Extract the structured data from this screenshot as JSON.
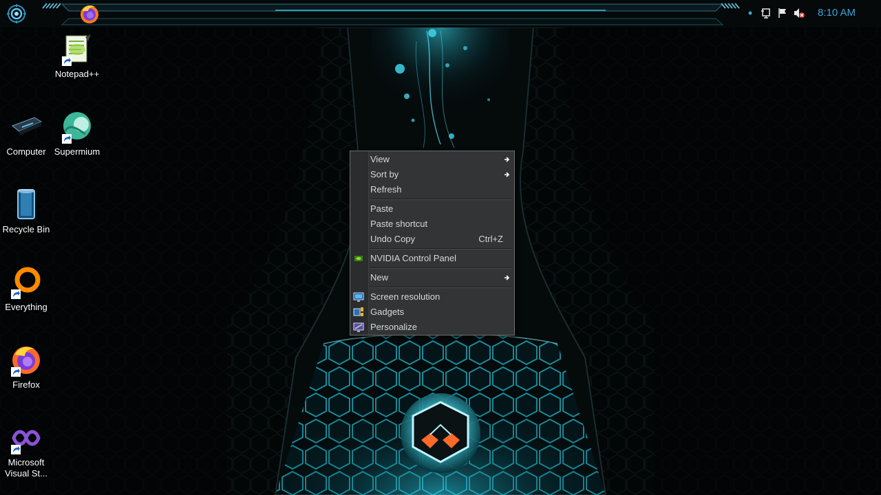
{
  "taskbar": {
    "pinned_app": "firefox-icon",
    "clock": "8:10 AM",
    "tray_icons": [
      "network-dot-icon",
      "action-center-icon",
      "flag-icon",
      "volume-muted-icon"
    ],
    "accent_color": "#3ea3d6"
  },
  "desktop_icons": [
    {
      "label": "Notepad++",
      "icon": "notepad-plus-plus-icon",
      "shortcut": true
    },
    {
      "label": "Computer",
      "icon": "computer-icon",
      "shortcut": false
    },
    {
      "label": "Supermium",
      "icon": "supermium-icon",
      "shortcut": true
    },
    {
      "label": "Recycle Bin",
      "icon": "recycle-bin-icon",
      "shortcut": false
    },
    {
      "label": "Everything",
      "icon": "everything-icon",
      "shortcut": true
    },
    {
      "label": "Firefox",
      "icon": "firefox-icon",
      "shortcut": true
    },
    {
      "label": "Microsoft Visual St...",
      "icon": "visual-studio-icon",
      "shortcut": true
    }
  ],
  "context_menu": {
    "items": [
      {
        "label": "View",
        "submenu": true
      },
      {
        "label": "Sort by",
        "submenu": true
      },
      {
        "label": "Refresh"
      },
      {
        "label": "Paste"
      },
      {
        "label": "Paste shortcut"
      },
      {
        "label": "Undo Copy",
        "shortcut": "Ctrl+Z"
      },
      {
        "label": "NVIDIA Control Panel",
        "icon": "nvidia-icon"
      },
      {
        "label": "New",
        "submenu": true
      },
      {
        "label": "Screen resolution",
        "icon": "monitor-icon"
      },
      {
        "label": "Gadgets",
        "icon": "gadgets-icon"
      },
      {
        "label": "Personalize",
        "icon": "personalize-icon"
      }
    ]
  }
}
